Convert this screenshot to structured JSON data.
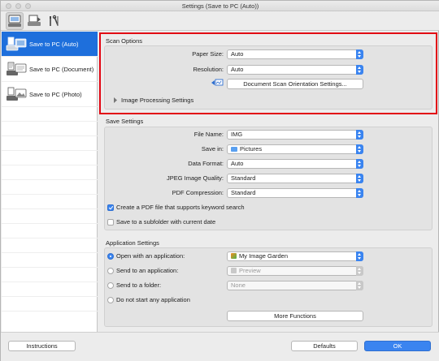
{
  "window": {
    "title": "Settings (Save to PC (Auto))"
  },
  "toolbar": {
    "tabs": [
      {
        "name": "scan-from-computer",
        "icon": "scanner-monitor-icon"
      },
      {
        "name": "scan-from-operation-panel",
        "icon": "scanner-document-icon"
      },
      {
        "name": "general-settings",
        "icon": "tools-icon"
      }
    ]
  },
  "sidebar": {
    "items": [
      {
        "label": "Save to PC (Auto)",
        "selected": true
      },
      {
        "label": "Save to PC (Document)",
        "selected": false
      },
      {
        "label": "Save to PC (Photo)",
        "selected": false
      }
    ]
  },
  "scan_options": {
    "title": "Scan Options",
    "paper_size_label": "Paper Size:",
    "paper_size_value": "Auto",
    "resolution_label": "Resolution:",
    "resolution_value": "Auto",
    "orientation_button": "Document Scan Orientation Settings...",
    "image_processing_label": "Image Processing Settings"
  },
  "save_settings": {
    "title": "Save Settings",
    "file_name_label": "File Name:",
    "file_name_value": "IMG",
    "save_in_label": "Save in:",
    "save_in_value": "Pictures",
    "data_format_label": "Data Format:",
    "data_format_value": "Auto",
    "jpeg_quality_label": "JPEG Image Quality:",
    "jpeg_quality_value": "Standard",
    "pdf_compression_label": "PDF Compression:",
    "pdf_compression_value": "Standard",
    "keyword_search_label": "Create a PDF file that supports keyword search",
    "keyword_search_checked": true,
    "subfolder_label": "Save to a subfolder with current date",
    "subfolder_checked": false
  },
  "application_settings": {
    "title": "Application Settings",
    "open_with_label": "Open with an application:",
    "open_with_value": "My Image Garden",
    "send_to_app_label": "Send to an application:",
    "send_to_app_value": "Preview",
    "send_to_folder_label": "Send to a folder:",
    "send_to_folder_value": "None",
    "do_not_start_label": "Do not start any application",
    "selected_option": "open_with",
    "more_functions_button": "More Functions"
  },
  "footer": {
    "instructions_button": "Instructions",
    "defaults_button": "Defaults",
    "ok_button": "OK"
  },
  "colors": {
    "accent": "#3a84f0",
    "highlight_box": "#e20613",
    "selection": "#1e6fdc"
  }
}
